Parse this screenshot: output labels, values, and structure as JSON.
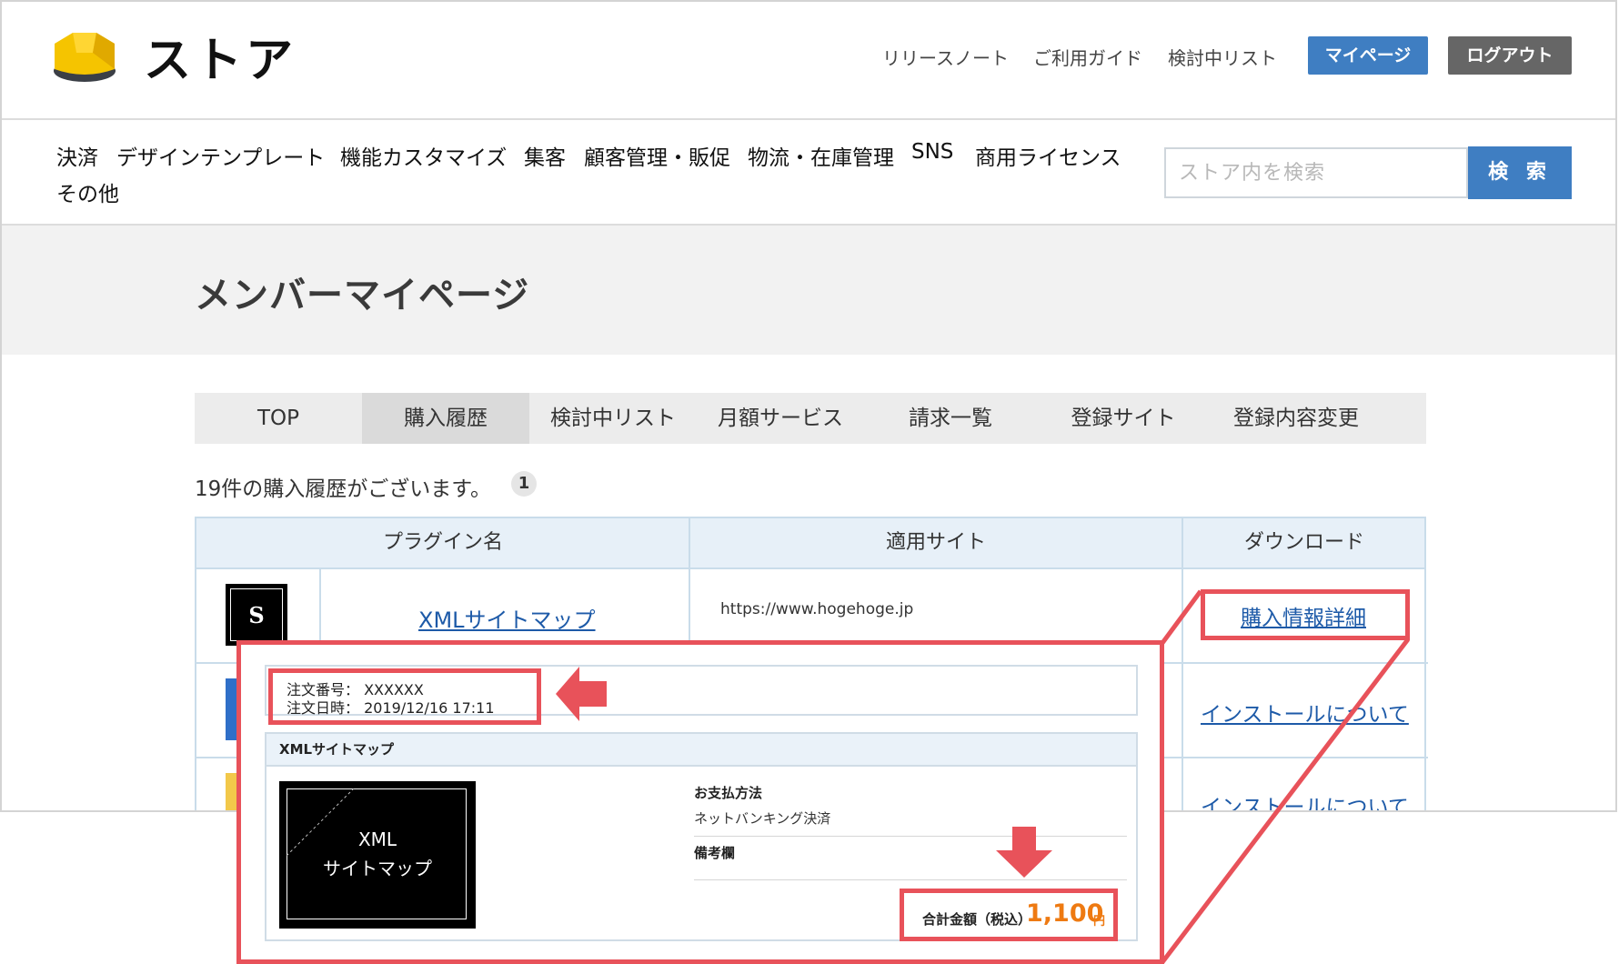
{
  "header": {
    "brand": "ストア",
    "links": [
      "リリースノート",
      "ご利用ガイド",
      "検討中リスト"
    ],
    "mypage_button": "マイページ",
    "logout_button": "ログアウト"
  },
  "categories": [
    "決済",
    "デザインテンプレート",
    "機能カスタマイズ",
    "集客",
    "顧客管理・販促",
    "物流・在庫管理",
    "SNS",
    "商用ライセンス",
    "その他"
  ],
  "search": {
    "placeholder": "ストア内を検索",
    "button": "検 索"
  },
  "page_title": "メンバーマイページ",
  "tabs": [
    "TOP",
    "購入履歴",
    "検討中リスト",
    "月額サービス",
    "請求一覧",
    "登録サイト",
    "登録内容変更"
  ],
  "active_tab": "購入履歴",
  "history": {
    "count_text": "19件の購入履歴がございます。",
    "page": "1"
  },
  "table": {
    "headers": [
      "プラグイン名",
      "適用サイト",
      "ダウンロード"
    ],
    "rows": [
      {
        "icon_letter": "S",
        "name": "XMLサイトマップ",
        "site": "https://www.hogehoge.jp",
        "link": "購入情報詳細"
      },
      {
        "link": "インストールについて"
      },
      {
        "link": "インストールについて"
      }
    ]
  },
  "detail": {
    "order_number": "注文番号： XXXXXX",
    "order_date": "注文日時： 2019/12/16 17:11",
    "product_title": "XMLサイトマップ",
    "thumb_line1": "XML",
    "thumb_line2": "サイトマップ",
    "payment_label": "お支払方法",
    "payment_value": "ネットバンキング決済",
    "remarks_label": "備考欄",
    "total_label": "合計金額（税込）",
    "total_value": "1,100",
    "currency": "円"
  },
  "colors": {
    "accent_blue": "#3f7ec2",
    "highlight_red": "#e8525a",
    "price_orange": "#ee7a12",
    "logout_gray": "#666666"
  }
}
